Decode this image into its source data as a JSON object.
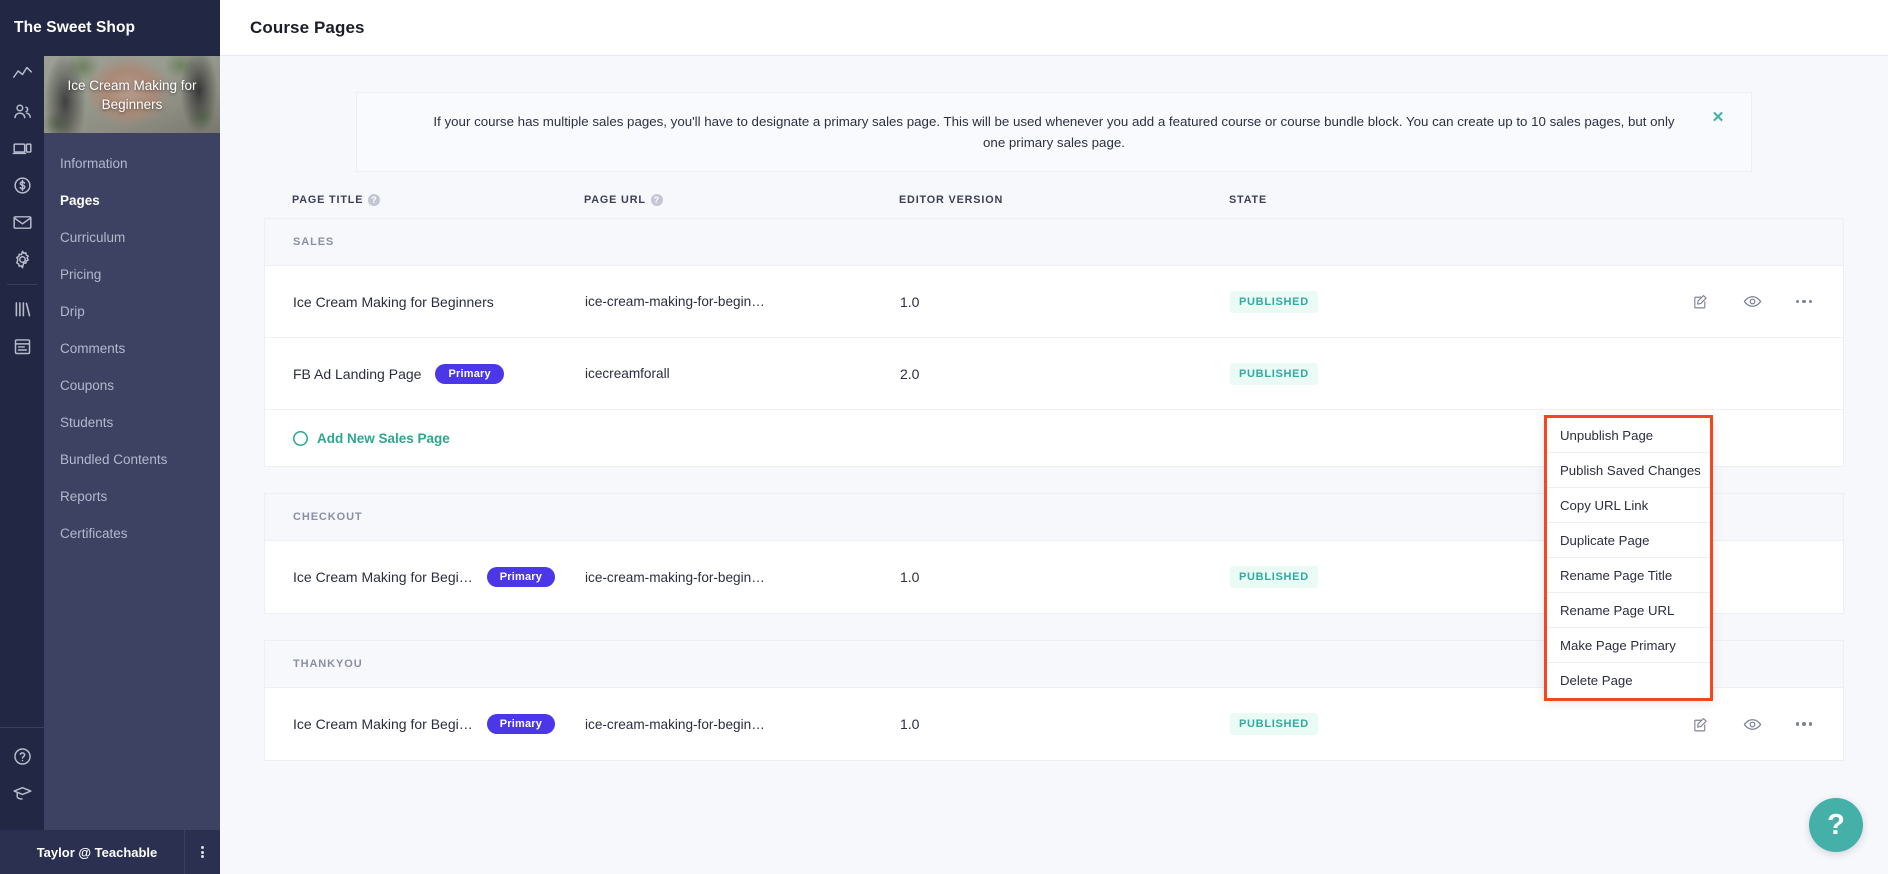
{
  "brand": {
    "name": "The Sweet Shop"
  },
  "rail": {
    "icons": [
      {
        "name": "analytics-icon"
      },
      {
        "name": "users-icon"
      },
      {
        "name": "devices-icon"
      },
      {
        "name": "dollar-circle-icon"
      },
      {
        "name": "mail-icon"
      },
      {
        "name": "gear-icon"
      },
      {
        "name": "library-icon"
      },
      {
        "name": "calendar-icon"
      }
    ],
    "bottom_icons": [
      {
        "name": "help-circle-icon"
      },
      {
        "name": "graduation-cap-icon"
      }
    ]
  },
  "sidebar": {
    "course_title": "Ice Cream Making for Beginners",
    "items": [
      {
        "label": "Information",
        "active": false
      },
      {
        "label": "Pages",
        "active": true
      },
      {
        "label": "Curriculum",
        "active": false
      },
      {
        "label": "Pricing",
        "active": false
      },
      {
        "label": "Drip",
        "active": false
      },
      {
        "label": "Comments",
        "active": false
      },
      {
        "label": "Coupons",
        "active": false
      },
      {
        "label": "Students",
        "active": false
      },
      {
        "label": "Bundled Contents",
        "active": false
      },
      {
        "label": "Reports",
        "active": false
      },
      {
        "label": "Certificates",
        "active": false
      }
    ],
    "user": "Taylor @ Teachable"
  },
  "header": {
    "title": "Course Pages"
  },
  "banner": {
    "text": "If your course has multiple sales pages, you'll have to designate a primary sales page. This will be used whenever you add a featured course or course bundle block. You can create up to 10 sales pages, but only one primary sales page.",
    "close_label": "✕"
  },
  "table": {
    "columns": {
      "page_title": "PAGE TITLE",
      "page_url": "PAGE URL",
      "editor_version": "EDITOR VERSION",
      "state": "STATE"
    },
    "help_glyph": "?",
    "sections": [
      {
        "name": "SALES",
        "rows": [
          {
            "title": "Ice Cream Making for Beginners",
            "primary": false,
            "primary_label": "",
            "url": "ice-cream-making-for-begin…",
            "version": "1.0",
            "state": "PUBLISHED"
          },
          {
            "title": "FB Ad Landing Page",
            "primary": true,
            "primary_label": "Primary",
            "url": "icecreamforall",
            "version": "2.0",
            "state": "PUBLISHED"
          }
        ],
        "add_link": "Add New Sales Page"
      },
      {
        "name": "CHECKOUT",
        "rows": [
          {
            "title": "Ice Cream Making for Begi…",
            "primary": true,
            "primary_label": "Primary",
            "url": "ice-cream-making-for-begin…",
            "version": "1.0",
            "state": "PUBLISHED"
          }
        ],
        "add_link": ""
      },
      {
        "name": "THANKYOU",
        "rows": [
          {
            "title": "Ice Cream Making for Begi…",
            "primary": true,
            "primary_label": "Primary",
            "url": "ice-cream-making-for-begin…",
            "version": "1.0",
            "state": "PUBLISHED"
          }
        ],
        "add_link": ""
      }
    ]
  },
  "context_menu": {
    "items": [
      "Unpublish Page",
      "Publish Saved Changes",
      "Copy URL Link",
      "Duplicate Page",
      "Rename Page Title",
      "Rename Page URL",
      "Make Page Primary",
      "Delete Page"
    ]
  },
  "help_fab": {
    "glyph": "?"
  },
  "colors": {
    "sidebar_dark": "#222743",
    "sidebar_light": "#3d4263",
    "primary_badge": "#4b36e8",
    "published_text": "#34a9a0",
    "published_bg": "#eafbf6",
    "accent_teal": "#2ba88e",
    "menu_highlight": "#f4461f",
    "fab": "#44b0a8"
  }
}
